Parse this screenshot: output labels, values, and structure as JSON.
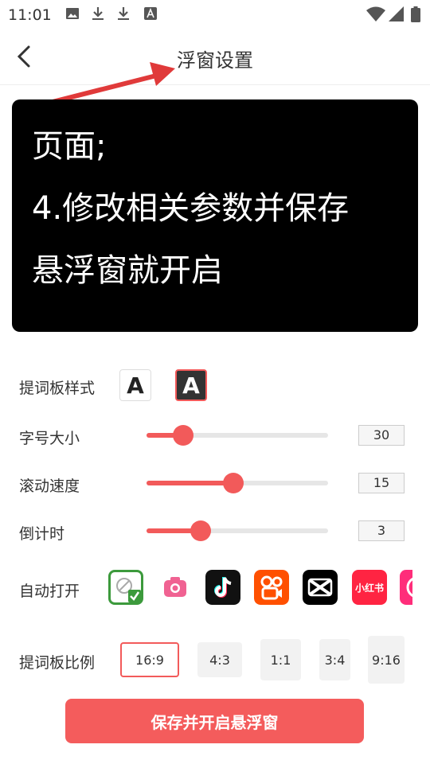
{
  "status": {
    "time": "11:01"
  },
  "header": {
    "title": "浮窗设置",
    "back_icon": "back-arrow-icon"
  },
  "preview": {
    "lines": [
      "页面;",
      "4.修改相关参数并保存",
      "悬浮窗就开启"
    ]
  },
  "style_row": {
    "label": "提词板样式",
    "option_glyph": "A",
    "selected": "dark"
  },
  "font_size": {
    "label": "字号大小",
    "value": "30",
    "fraction": 0.2
  },
  "scroll_speed": {
    "label": "滚动速度",
    "value": "15",
    "fraction": 0.48
  },
  "countdown": {
    "label": "倒计时",
    "value": "3",
    "fraction": 0.3
  },
  "auto_open": {
    "label": "自动打开",
    "apps": [
      {
        "name": "none",
        "icon": "no-app-selected-icon",
        "selected": true
      },
      {
        "name": "camera",
        "icon": "camera-icon"
      },
      {
        "name": "douyin",
        "icon": "douyin-icon"
      },
      {
        "name": "kuaishou",
        "icon": "kuaishou-icon"
      },
      {
        "name": "capcut",
        "icon": "capcut-icon"
      },
      {
        "name": "xiaohongshu",
        "icon": "xiaohongshu-icon",
        "text": "小红书"
      },
      {
        "name": "partial",
        "icon": "partial-app-icon"
      }
    ]
  },
  "ratio": {
    "label": "提词板比例",
    "options": [
      "16:9",
      "4:3",
      "1:1",
      "3:4",
      "9:16"
    ],
    "selected": "16:9"
  },
  "save_button": {
    "label": "保存并开启悬浮窗"
  },
  "colors": {
    "accent": "#f25a5a",
    "preview_bg": "#000000",
    "annotation_arrow": "#e03a3a"
  }
}
